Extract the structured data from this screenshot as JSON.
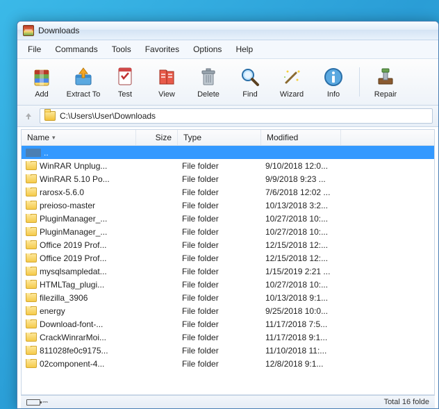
{
  "window": {
    "title": "Downloads"
  },
  "menubar": [
    "File",
    "Commands",
    "Tools",
    "Favorites",
    "Options",
    "Help"
  ],
  "toolbar": [
    {
      "id": "add",
      "label": "Add"
    },
    {
      "id": "extract",
      "label": "Extract To"
    },
    {
      "id": "test",
      "label": "Test"
    },
    {
      "id": "view",
      "label": "View"
    },
    {
      "id": "delete",
      "label": "Delete"
    },
    {
      "id": "find",
      "label": "Find"
    },
    {
      "id": "wizard",
      "label": "Wizard"
    },
    {
      "id": "info",
      "label": "Info"
    },
    {
      "id": "repair",
      "label": "Repair"
    }
  ],
  "address": {
    "path": "C:\\Users\\User\\Downloads"
  },
  "columns": {
    "name": "Name",
    "size": "Size",
    "type": "Type",
    "modified": "Modified"
  },
  "rows": [
    {
      "name": "..",
      "type": "",
      "modified": "",
      "updir": true,
      "selected": true
    },
    {
      "name": "WinRAR Unplug...",
      "type": "File folder",
      "modified": "9/10/2018 12:0..."
    },
    {
      "name": "WinRAR 5.10 Po...",
      "type": "File folder",
      "modified": "9/9/2018 9:23 ..."
    },
    {
      "name": "rarosx-5.6.0",
      "type": "File folder",
      "modified": "7/6/2018 12:02 ..."
    },
    {
      "name": "preioso-master",
      "type": "File folder",
      "modified": "10/13/2018 3:2..."
    },
    {
      "name": "PluginManager_...",
      "type": "File folder",
      "modified": "10/27/2018 10:..."
    },
    {
      "name": "PluginManager_...",
      "type": "File folder",
      "modified": "10/27/2018 10:..."
    },
    {
      "name": "Office 2019 Prof...",
      "type": "File folder",
      "modified": "12/15/2018 12:..."
    },
    {
      "name": "Office 2019 Prof...",
      "type": "File folder",
      "modified": "12/15/2018 12:..."
    },
    {
      "name": "mysqlsampledat...",
      "type": "File folder",
      "modified": "1/15/2019 2:21 ..."
    },
    {
      "name": "HTMLTag_plugi...",
      "type": "File folder",
      "modified": "10/27/2018 10:..."
    },
    {
      "name": "filezilla_3906",
      "type": "File folder",
      "modified": "10/13/2018 9:1..."
    },
    {
      "name": "energy",
      "type": "File folder",
      "modified": "9/25/2018 10:0..."
    },
    {
      "name": "Download-font-...",
      "type": "File folder",
      "modified": "11/17/2018 7:5..."
    },
    {
      "name": "CrackWinrarMoi...",
      "type": "File folder",
      "modified": "11/17/2018 9:1..."
    },
    {
      "name": "811028fe0c9175...",
      "type": "File folder",
      "modified": "11/10/2018 11:..."
    },
    {
      "name": "02component-4...",
      "type": "File folder",
      "modified": "12/8/2018 9:1..."
    }
  ],
  "status": {
    "right": "Total 16 folde"
  }
}
